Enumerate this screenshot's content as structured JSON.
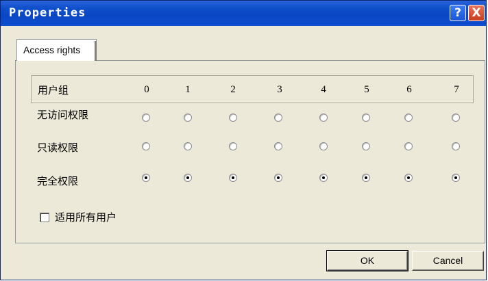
{
  "window": {
    "title": "Properties",
    "help_label": "?",
    "close_label": "X"
  },
  "tabs": [
    {
      "label": "Access rights",
      "active": true
    }
  ],
  "table": {
    "header_label": "用户组",
    "columns": [
      "0",
      "1",
      "2",
      "3",
      "4",
      "5",
      "6",
      "7"
    ],
    "rows": [
      {
        "label": "无访问权限",
        "selected": [
          false,
          false,
          false,
          false,
          false,
          false,
          false,
          false
        ]
      },
      {
        "label": "只读权限",
        "selected": [
          false,
          false,
          false,
          false,
          false,
          false,
          false,
          false
        ]
      },
      {
        "label": "完全权限",
        "selected": [
          true,
          true,
          true,
          true,
          true,
          true,
          true,
          true
        ]
      }
    ]
  },
  "apply_all": {
    "label": "适用所有用户",
    "checked": false
  },
  "buttons": {
    "ok_label": "OK",
    "cancel_label": "Cancel"
  }
}
